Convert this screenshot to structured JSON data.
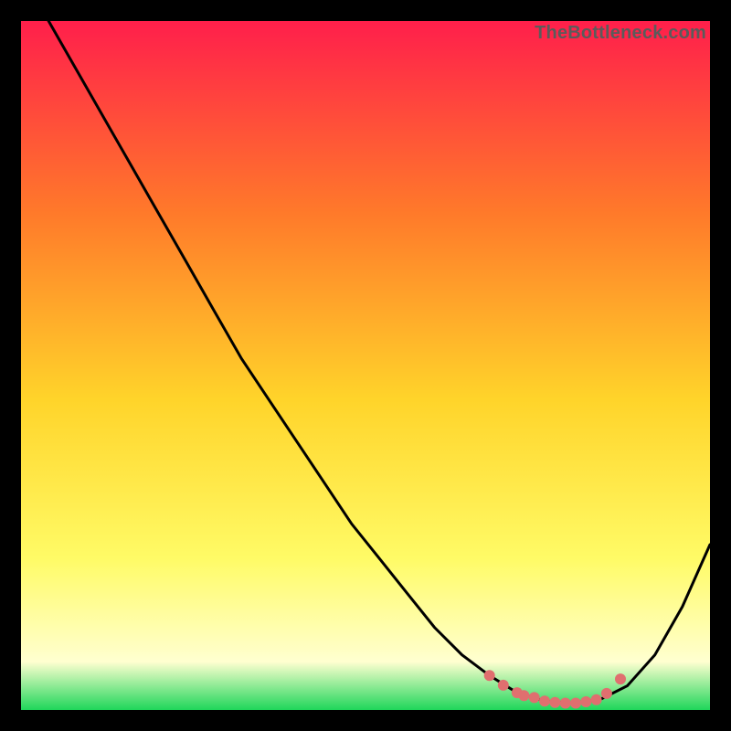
{
  "watermark": "TheBottleneck.com",
  "colors": {
    "background": "#000000",
    "gradient_top": "#ff1f4b",
    "gradient_upper_mid": "#ff7a2a",
    "gradient_mid": "#ffd42a",
    "gradient_lower_mid": "#fffb66",
    "gradient_near_bottom": "#ffffd0",
    "gradient_bottom": "#1fd65a",
    "curve": "#000000",
    "markers": "#e06f6f"
  },
  "chart_data": {
    "type": "line",
    "title": "",
    "xlabel": "",
    "ylabel": "",
    "xlim": [
      0,
      100
    ],
    "ylim": [
      0,
      100
    ],
    "x": [
      0,
      4,
      8,
      12,
      16,
      20,
      24,
      28,
      32,
      36,
      40,
      44,
      48,
      52,
      56,
      60,
      64,
      68,
      72,
      76,
      80,
      84,
      88,
      92,
      96,
      100
    ],
    "values": [
      107,
      100,
      93,
      86,
      79,
      72,
      65,
      58,
      51,
      45,
      39,
      33,
      27,
      22,
      17,
      12,
      8,
      5,
      2.5,
      1.3,
      1,
      1.5,
      3.5,
      8,
      15,
      24
    ],
    "minimum_x": 80,
    "markers_x": [
      68,
      70,
      72,
      73,
      74.5,
      76,
      77.5,
      79,
      80.5,
      82,
      83.5,
      85,
      87
    ],
    "markers_y": [
      5.0,
      3.6,
      2.5,
      2.1,
      1.8,
      1.3,
      1.1,
      1.0,
      1.0,
      1.2,
      1.5,
      2.4,
      4.5
    ]
  }
}
